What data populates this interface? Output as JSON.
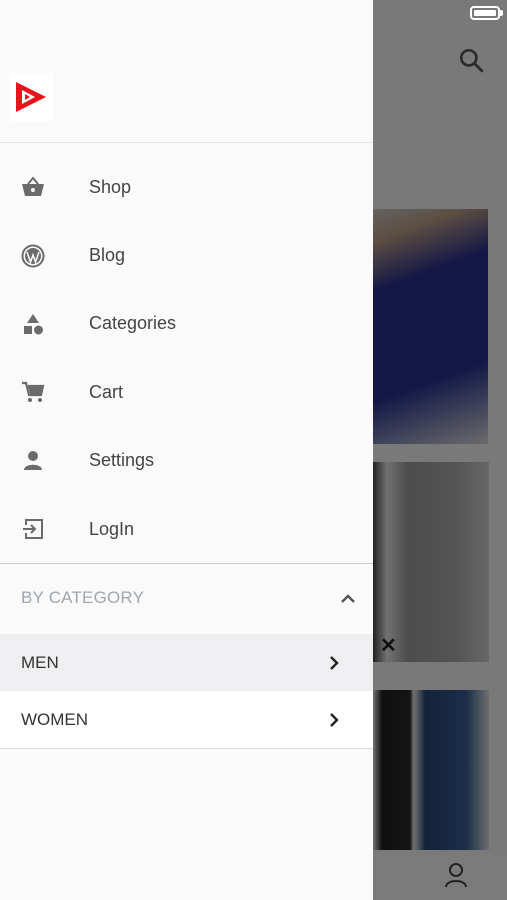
{
  "drawer": {
    "menu": [
      {
        "label": "Shop",
        "icon": "shopping-basket-icon"
      },
      {
        "label": "Blog",
        "icon": "wordpress-icon"
      },
      {
        "label": "Categories",
        "icon": "category-shapes-icon"
      },
      {
        "label": "Cart",
        "icon": "cart-icon"
      },
      {
        "label": "Settings",
        "icon": "person-icon"
      },
      {
        "label": "LogIn",
        "icon": "login-icon"
      }
    ],
    "category_section": {
      "title": "BY CATEGORY",
      "items": [
        {
          "label": "MEN"
        },
        {
          "label": "WOMEN"
        }
      ]
    }
  },
  "colors": {
    "brand_red": "#e8141b",
    "drawer_bg": "#fafafa",
    "scrim": "rgba(0,0,0,0.5)"
  }
}
